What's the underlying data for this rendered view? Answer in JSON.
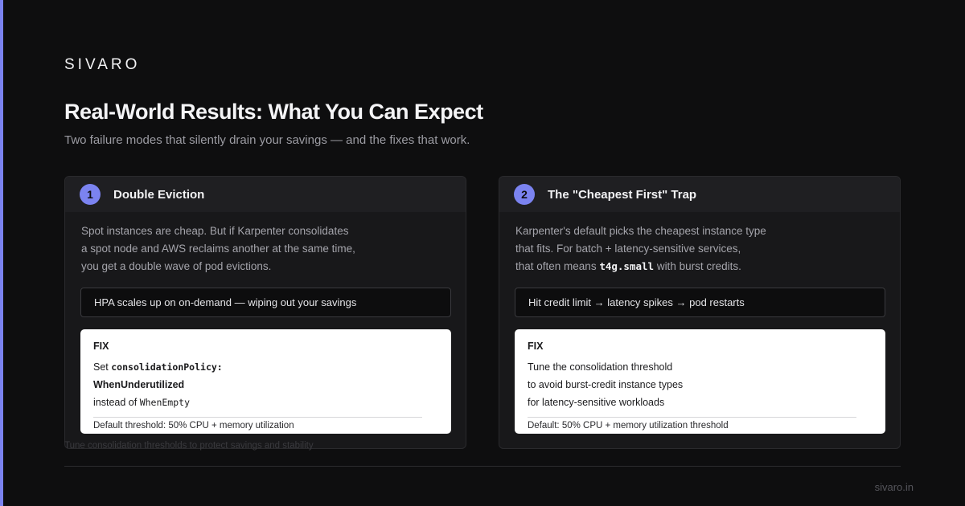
{
  "brand": "SIVARO",
  "title": "Real-World Results: What You Can Expect",
  "subtitle": "Two failure modes that silently drain your savings — and the fixes that work.",
  "colors": {
    "accent": "#7b83f0",
    "background": "#0e0e0f",
    "card": "#18181a"
  },
  "cards": [
    {
      "number": "1",
      "title": "Double Eviction",
      "desc": [
        "Spot instances are cheap. But if Karpenter consolidates",
        "a spot node and AWS reclaims another at the same time,",
        "you get a double wave of pod evictions."
      ],
      "warning": "HPA scales up on on-demand — wiping out your savings",
      "fix": {
        "label": "FIX",
        "line1_prefix": "Set ",
        "line1_code": "consolidationPolicy:",
        "line2": "WhenUnderutilized",
        "line3_prefix": "instead of ",
        "line3_code": "WhenEmpty",
        "footer": "Default threshold: 50% CPU + memory utilization"
      }
    },
    {
      "number": "2",
      "title": "The \"Cheapest First\" Trap",
      "desc": [
        "Karpenter's default picks the cheapest instance type",
        "that fits. For batch + latency-sensitive services,"
      ],
      "desc_line3_prefix": "that often means ",
      "desc_line3_code": "t4g.small",
      "desc_line3_suffix": " with burst credits.",
      "warning": "Hit credit limit → latency spikes → pod restarts",
      "fix": {
        "label": "FIX",
        "lines": [
          "Tune the consolidation threshold",
          "to avoid burst-credit instance types",
          "for latency-sensitive workloads"
        ],
        "footer": "Default: 50% CPU + memory utilization threshold"
      }
    }
  ],
  "footnote": "Tune consolidation thresholds to protect savings and stability",
  "site": "sivaro.in"
}
